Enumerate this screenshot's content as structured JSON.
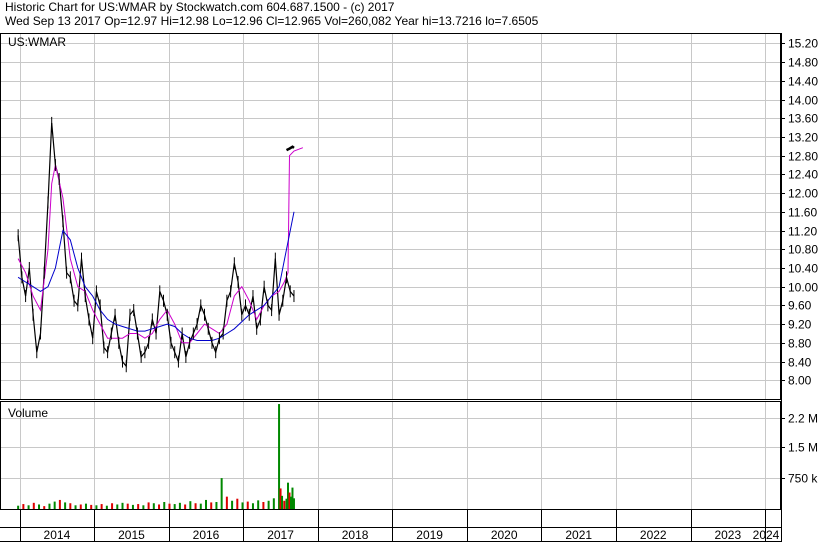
{
  "header": {
    "line1": "Historic Chart for US:WMAR by Stockwatch.com 604.687.1500 - (c) 2017",
    "line2": "Wed Sep 13 2017   Op=12.97   Hi=12.98   Lo=12.96   Cl=12.965   Vol=260,082   Year hi=13.7216   lo=7.6505"
  },
  "chart_data": [
    {
      "type": "line",
      "title": "US:WMAR",
      "ylim": [
        7.6,
        15.4
      ],
      "y_ticks": [
        "15.20",
        "14.80",
        "14.40",
        "14.00",
        "13.60",
        "13.20",
        "12.80",
        "12.40",
        "12.00",
        "11.60",
        "11.20",
        "10.80",
        "10.40",
        "10.00",
        "9.60",
        "9.20",
        "8.80",
        "8.40",
        "8.00"
      ],
      "x_ticks": [
        "2014",
        "2015",
        "2016",
        "2017",
        "2018",
        "2019",
        "2020",
        "2021",
        "2022",
        "2023",
        "2024"
      ],
      "grid": true,
      "colors": {
        "price": "#000000",
        "ma_short": "#cc00cc",
        "ma_long": "#0000cc"
      },
      "series": [
        {
          "key": "price",
          "x": [
            2013.98,
            2014.03,
            2014.08,
            2014.13,
            2014.18,
            2014.23,
            2014.28,
            2014.33,
            2014.38,
            2014.43,
            2014.48,
            2014.53,
            2014.58,
            2014.63,
            2014.68,
            2014.73,
            2014.78,
            2014.83,
            2014.88,
            2014.93,
            2014.98,
            2015.03,
            2015.08,
            2015.13,
            2015.18,
            2015.23,
            2015.28,
            2015.33,
            2015.38,
            2015.43,
            2015.48,
            2015.53,
            2015.58,
            2015.63,
            2015.68,
            2015.73,
            2015.78,
            2015.83,
            2015.88,
            2015.93,
            2015.98,
            2016.03,
            2016.08,
            2016.13,
            2016.18,
            2016.23,
            2016.28,
            2016.33,
            2016.38,
            2016.43,
            2016.48,
            2016.53,
            2016.58,
            2016.63,
            2016.68,
            2016.73,
            2016.78,
            2016.83,
            2016.88,
            2016.93,
            2016.98,
            2017.03,
            2017.08,
            2017.13,
            2017.18,
            2017.23,
            2017.28,
            2017.33,
            2017.38,
            2017.43,
            2017.48,
            2017.53,
            2017.58,
            2017.63,
            2017.68
          ],
          "y": [
            11.1,
            10.2,
            9.8,
            10.4,
            9.4,
            8.6,
            9.0,
            10.3,
            11.8,
            13.5,
            12.6,
            12.3,
            11.4,
            10.3,
            10.2,
            9.7,
            9.6,
            10.6,
            9.8,
            9.3,
            8.9,
            9.9,
            9.6,
            8.7,
            8.6,
            9.0,
            9.4,
            8.8,
            8.4,
            8.3,
            9.4,
            9.5,
            9.0,
            8.5,
            8.6,
            8.8,
            9.3,
            9.0,
            9.9,
            9.7,
            9.4,
            8.8,
            8.6,
            8.4,
            9.0,
            8.5,
            8.8,
            9.0,
            9.2,
            9.6,
            9.4,
            9.1,
            8.8,
            8.6,
            8.9,
            9.0,
            9.7,
            9.9,
            10.5,
            10.1,
            9.4,
            9.6,
            9.4,
            9.8,
            9.1,
            9.3,
            10.0,
            9.6,
            9.5,
            10.6,
            9.4,
            9.7,
            10.2,
            9.9,
            9.8
          ]
        },
        {
          "key": "ma_short",
          "x": [
            2013.98,
            2014.08,
            2014.18,
            2014.28,
            2014.38,
            2014.43,
            2014.48,
            2014.58,
            2014.68,
            2014.78,
            2014.88,
            2014.98,
            2015.08,
            2015.18,
            2015.28,
            2015.38,
            2015.48,
            2015.58,
            2015.68,
            2015.78,
            2015.88,
            2015.98,
            2016.08,
            2016.18,
            2016.28,
            2016.38,
            2016.48,
            2016.58,
            2016.68,
            2016.78,
            2016.88,
            2016.98,
            2017.08,
            2017.18,
            2017.28,
            2017.38,
            2017.48,
            2017.55,
            2017.6,
            2017.62,
            2017.68,
            2017.8
          ],
          "y": [
            10.6,
            10.3,
            9.8,
            9.5,
            10.8,
            12.2,
            12.6,
            11.9,
            10.6,
            10.0,
            9.9,
            9.5,
            9.2,
            8.9,
            8.9,
            8.9,
            9.0,
            9.0,
            8.9,
            9.0,
            9.3,
            9.5,
            9.2,
            8.8,
            8.8,
            9.0,
            9.2,
            9.1,
            9.0,
            9.2,
            9.8,
            10.0,
            9.7,
            9.3,
            9.6,
            9.8,
            9.9,
            10.1,
            10.3,
            12.8,
            12.9,
            12.97
          ]
        },
        {
          "key": "ma_long",
          "x": [
            2013.98,
            2014.08,
            2014.18,
            2014.28,
            2014.38,
            2014.48,
            2014.58,
            2014.68,
            2014.78,
            2014.88,
            2014.98,
            2015.08,
            2015.18,
            2015.28,
            2015.38,
            2015.48,
            2015.58,
            2015.68,
            2015.78,
            2015.88,
            2015.98,
            2016.08,
            2016.18,
            2016.28,
            2016.38,
            2016.48,
            2016.58,
            2016.68,
            2016.78,
            2016.88,
            2016.98,
            2017.08,
            2017.18,
            2017.28,
            2017.38,
            2017.48,
            2017.58,
            2017.68
          ],
          "y": [
            10.2,
            10.1,
            10.0,
            9.9,
            10.0,
            10.4,
            11.2,
            11.0,
            10.4,
            10.0,
            9.8,
            9.5,
            9.3,
            9.2,
            9.15,
            9.1,
            9.05,
            9.05,
            9.1,
            9.15,
            9.2,
            9.15,
            9.0,
            8.9,
            8.85,
            8.85,
            8.85,
            8.9,
            9.0,
            9.1,
            9.25,
            9.4,
            9.5,
            9.6,
            9.8,
            10.0,
            10.8,
            11.6
          ]
        },
        {
          "key": "recent",
          "x": [
            2017.58,
            2017.62,
            2017.66,
            2017.68
          ],
          "y": [
            12.92,
            12.95,
            12.99,
            12.965
          ]
        }
      ]
    },
    {
      "type": "bar",
      "title": "Volume",
      "ylim": [
        0,
        2600000
      ],
      "y_ticks": [
        "2.2 M",
        "1.5 M",
        "750 k"
      ],
      "y_tick_values": [
        2200000,
        1500000,
        750000
      ],
      "colors": {
        "up": "#008800",
        "down": "#dd0000"
      },
      "x": [
        2013.98,
        2014.05,
        2014.12,
        2014.19,
        2014.26,
        2014.33,
        2014.4,
        2014.47,
        2014.54,
        2014.61,
        2014.68,
        2014.75,
        2014.82,
        2014.89,
        2014.96,
        2015.03,
        2015.1,
        2015.17,
        2015.24,
        2015.31,
        2015.38,
        2015.45,
        2015.52,
        2015.59,
        2015.66,
        2015.73,
        2015.8,
        2015.87,
        2015.94,
        2016.01,
        2016.08,
        2016.15,
        2016.22,
        2016.29,
        2016.36,
        2016.43,
        2016.5,
        2016.57,
        2016.64,
        2016.71,
        2016.78,
        2016.85,
        2016.92,
        2016.99,
        2017.06,
        2017.13,
        2017.2,
        2017.27,
        2017.34,
        2017.41,
        2017.48,
        2017.5,
        2017.52,
        2017.55,
        2017.58,
        2017.6,
        2017.62,
        2017.64,
        2017.66,
        2017.68
      ],
      "values": [
        80000,
        120000,
        90000,
        150000,
        110000,
        70000,
        130000,
        180000,
        220000,
        160000,
        140000,
        90000,
        110000,
        130000,
        100000,
        90000,
        120000,
        80000,
        140000,
        110000,
        150000,
        130000,
        100000,
        120000,
        90000,
        160000,
        140000,
        110000,
        170000,
        130000,
        120000,
        150000,
        110000,
        190000,
        140000,
        130000,
        220000,
        160000,
        170000,
        750000,
        300000,
        200000,
        250000,
        160000,
        180000,
        140000,
        210000,
        170000,
        200000,
        260000,
        2550000,
        500000,
        320000,
        200000,
        250000,
        640000,
        400000,
        300000,
        520000,
        260000
      ],
      "up": [
        true,
        false,
        true,
        false,
        true,
        false,
        true,
        true,
        false,
        true,
        false,
        true,
        false,
        true,
        false,
        true,
        false,
        true,
        false,
        true,
        true,
        false,
        true,
        false,
        true,
        false,
        true,
        false,
        true,
        false,
        true,
        true,
        false,
        true,
        false,
        true,
        true,
        false,
        true,
        true,
        false,
        true,
        false,
        true,
        false,
        true,
        true,
        false,
        true,
        true,
        true,
        false,
        true,
        false,
        true,
        true,
        false,
        true,
        true,
        true
      ]
    }
  ]
}
